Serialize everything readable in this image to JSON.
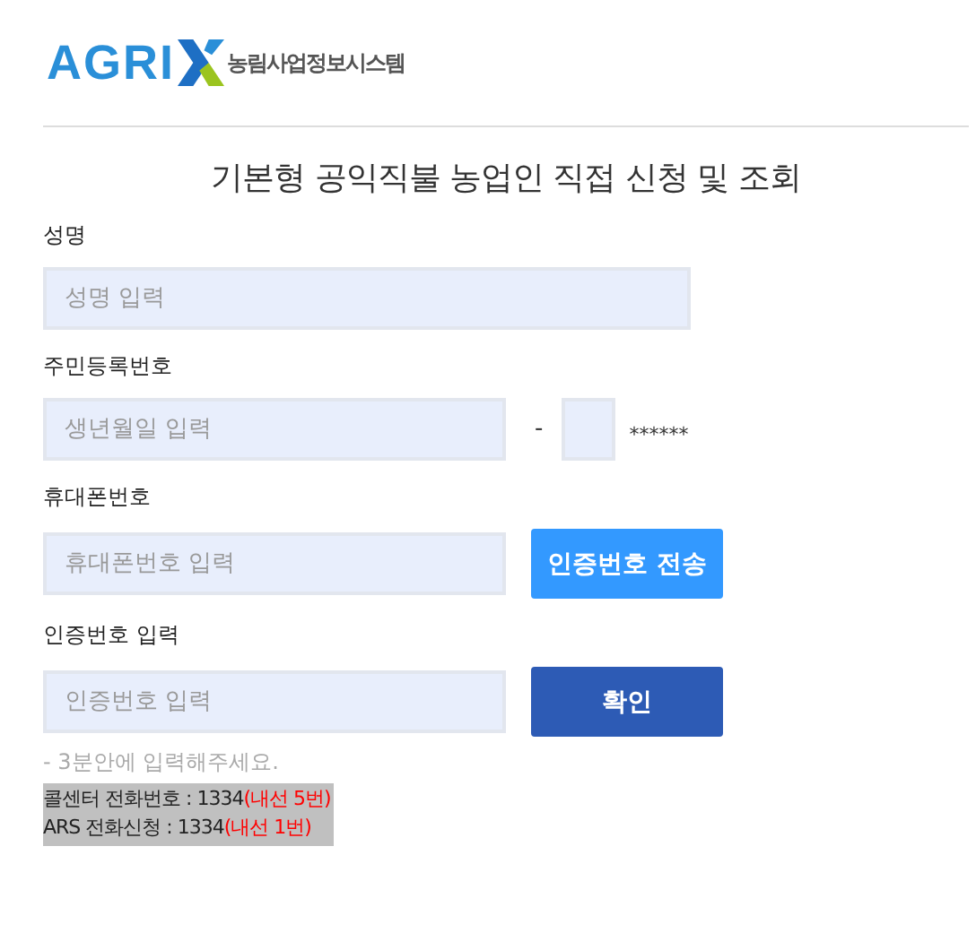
{
  "logo": {
    "wordmark": "AGRI",
    "subtitle": "농림사업정보시스템"
  },
  "title": "기본형 공익직불 농업인 직접 신청 및 조회",
  "form": [
    {
      "kind": "text",
      "label": "성명",
      "placeholder": "성명 입력"
    },
    {
      "kind": "rrn",
      "label": "주민등록번호",
      "placeholder": "생년월일 입력",
      "separator": "-",
      "masked": "******"
    },
    {
      "kind": "send",
      "label": "휴대폰번호",
      "placeholder": "휴대폰번호 입력",
      "button": "인증번호 전송"
    },
    {
      "kind": "confirm",
      "label": "인증번호 입력",
      "placeholder": "인증번호 입력",
      "button": "확인"
    }
  ],
  "hint": "- 3분안에 입력해주세요.",
  "contacts": [
    {
      "text": "콜센터 전화번호 : 1334",
      "ext": "(내선 5번)"
    },
    {
      "text": "ARS 전화신청 : 1334",
      "ext": "(내선 1번)"
    }
  ]
}
